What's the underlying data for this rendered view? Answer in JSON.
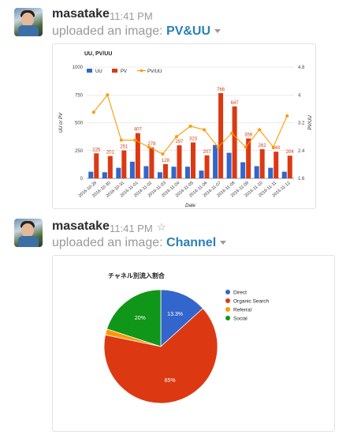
{
  "messages": [
    {
      "author": "masatake",
      "time": "11:41 PM",
      "action": "uploaded an image:",
      "file_name": "PV&UU"
    },
    {
      "author": "masatake",
      "time": "11:41 PM",
      "action": "uploaded an image:",
      "file_name": "Channel"
    }
  ],
  "icons": {
    "menu": "chevron-down-icon",
    "star": "star-outline-icon"
  },
  "colors": {
    "uu": "#3366cc",
    "pv": "#dc3912",
    "pvuu": "#ff9900",
    "direct": "#3366cc",
    "organic": "#dc3912",
    "referral": "#ff9900",
    "social": "#109618",
    "link": "#2a80b9"
  },
  "chart_data": [
    {
      "type": "bar",
      "title": "UU, PV/UU",
      "xlabel": "Date",
      "ylabel": "UU or PV",
      "ylabel_right": "PV/UU",
      "categories": [
        "2016-10-29",
        "2016-10-30",
        "2016-10-31",
        "2016-11-01",
        "2016-11-02",
        "2016-11-03",
        "2016-11-04",
        "2016-11-05",
        "2016-11-06",
        "2016-11-07",
        "2016-11-08",
        "2016-11-09",
        "2016-11-10",
        "2016-11-11",
        "2016-11-12"
      ],
      "series": [
        {
          "name": "UU",
          "kind": "bar",
          "values": [
            60,
            55,
            95,
            150,
            110,
            55,
            105,
            105,
            70,
            300,
            230,
            145,
            110,
            95,
            60
          ]
        },
        {
          "name": "PV",
          "kind": "bar",
          "values": [
            225,
            201,
            251,
            407,
            278,
            128,
            297,
            323,
            207,
            766,
            647,
            359,
            262,
            240,
            204
          ]
        },
        {
          "name": "PV/UU",
          "kind": "line",
          "axis": "right",
          "values": [
            3.5,
            4.0,
            2.7,
            2.7,
            2.5,
            2.3,
            2.8,
            3.1,
            3.0,
            2.5,
            2.9,
            2.5,
            3.0,
            2.5,
            3.4
          ]
        }
      ],
      "data_labels": [
        "225",
        "201",
        "251",
        "407",
        "278",
        "128",
        "297",
        "323",
        "207",
        "766",
        "647",
        "359",
        "262",
        "240",
        "204"
      ],
      "ylim": [
        0,
        1000
      ],
      "yticks": [
        "0",
        "250",
        "500",
        "750",
        "1000"
      ],
      "ylim_right": [
        1.6,
        4.8
      ],
      "yticks_right": [
        "1.6",
        "2.4",
        "3.2",
        "4",
        "4.8"
      ],
      "legend": "top-left",
      "grid": true
    },
    {
      "type": "pie",
      "title": "チャネル別流入割合",
      "categories": [
        "Direct",
        "Organic Search",
        "Referral",
        "Social"
      ],
      "values": [
        13.3,
        65,
        1.7,
        20
      ],
      "slice_labels": [
        "13.3%",
        "65%",
        "",
        "20%"
      ],
      "legend": "right"
    }
  ]
}
